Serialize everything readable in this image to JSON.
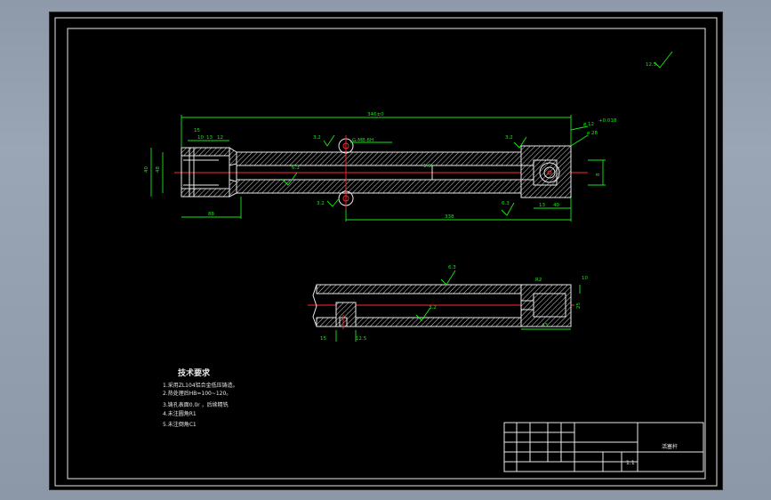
{
  "drawing": {
    "dimensions": {
      "overall_length": "346±0",
      "dia_12": "⌀ 12",
      "dia_12_tol": "+0.018",
      "dia_28": "⌀ 28",
      "thread": "G-M8-6H",
      "length_338": "338",
      "length_88": "88",
      "dim_15": "15",
      "dim_10": "10",
      "dim_13": "13",
      "dim_12": "12",
      "dim_40": "40",
      "dim_48": "48",
      "dim_13b": "13",
      "dim_40b": "40",
      "dim_8": "8",
      "dim_15b": "15",
      "dim_10b": "10",
      "dim_12_5": "12.5",
      "dim_43": "43",
      "dim_25": "25"
    },
    "roughness": {
      "top_right": "12.5",
      "r3_2a": "3.2",
      "r6_3": "6.3",
      "r1_6": "1.6",
      "r3_2b": "3.2",
      "r6_3b": "6.3",
      "r3_2c": "3.2",
      "r6_3c": "6.3",
      "r3_2d": "3.2"
    }
  },
  "notes": {
    "title": "技术要求",
    "items": [
      "1.采用ZL104铝合金低压铸造。",
      "2.热处理后HB=100~120。",
      "3.铸孔表面0.0r ，后续精铣",
      "4.未注圆角R1",
      "5.未注倒角C1"
    ]
  },
  "title_block": {
    "part_name": "活塞杆",
    "scale": "1:1"
  }
}
